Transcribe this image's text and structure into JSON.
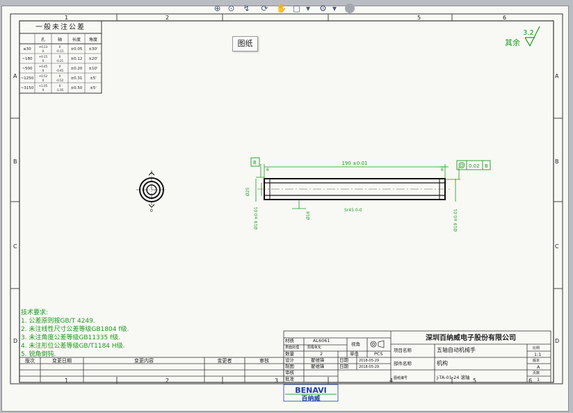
{
  "toolbar": {
    "icons": [
      "zoom-fit-icon",
      "zoom-area-icon",
      "previous-view-icon",
      "rotate-view-icon",
      "pan-icon",
      "display-style-icon",
      "dropdown-icon",
      "view-setting-icon",
      "dropdown-icon"
    ]
  },
  "tooltip": {
    "text": "图纸"
  },
  "border": {
    "top_numbers": [
      "1",
      "2",
      "5",
      "6"
    ],
    "bottom_numbers": [
      "1",
      "2",
      "3",
      "4",
      "5",
      "6"
    ],
    "left_letters": [
      "A",
      "B",
      "C",
      "D"
    ],
    "right_letters": [
      "A",
      "B",
      "C",
      "D"
    ]
  },
  "tolerance_table": {
    "title": "一般未注公差",
    "headers": [
      "孔",
      "轴",
      "长度",
      "角度"
    ],
    "rows": [
      {
        "range": "≤30",
        "hole": "+0.13\n0",
        "shaft": "0\n-0.13",
        "length": "±0.05",
        "angle": "±30'"
      },
      {
        "range": "~180",
        "hole": "+0.15\n0",
        "shaft": "0\n-0.21",
        "length": "±0.12",
        "angle": "±20'"
      },
      {
        "range": "~500",
        "hole": "+0.45\n0",
        "shaft": "0\n-0.45",
        "length": "±0.20",
        "angle": "±10'"
      },
      {
        "range": "~1250",
        "hole": "+0.52\n0",
        "shaft": "0\n-0.52",
        "length": "±0.31",
        "angle": "±5'"
      },
      {
        "range": "~3150",
        "hole": "+1.05\n0",
        "shaft": "0\n-1.05",
        "length": "±0.50",
        "angle": "±5'"
      }
    ]
  },
  "roughness": {
    "value": "3.2",
    "label": "其余"
  },
  "drawing": {
    "datum_label": "B",
    "length_dim": "190 ±0.01",
    "tol_frame_value": "0.02",
    "tol_frame_datum": "B",
    "dim_left_vertical": "Ø25",
    "dim_left_dia": "Ø19 ±0.01",
    "dim_inner": "Ø16",
    "dim_right_dia": "Ø19 ±0.01",
    "center_note": "Sr45 0-0",
    "dim_right_small": "6",
    "dim_left_small": "6",
    "section_mark": "0"
  },
  "notes": {
    "heading": "技术要求:",
    "lines": [
      "1. 公差原则按GB/T 4249.",
      "2. 未注线性尺寸公差等级GB1804  f级.",
      "3. 未注角度公差等级GB11335  f级.",
      "4. 未注形位公差等级GB/T1184  H级.",
      "5. 锐角倒钝."
    ]
  },
  "revision_block": {
    "headers": [
      "版次",
      "变更日期",
      "变更内容",
      "变更者",
      "审核"
    ]
  },
  "title_block": {
    "material_label": "材质",
    "material_value": "AL6061",
    "finish_label": "表面处理",
    "finish_value": "阳极氧化",
    "qty_label": "数量",
    "qty_value": "2",
    "unit_label": "单位",
    "unit_value": "PCS",
    "view_label": "视角",
    "design_label": "设计",
    "design_name": "翟维锋",
    "design_date_label": "日期",
    "design_date": "2018-05-29",
    "draw_label": "制图",
    "draw_name": "翟维锋",
    "draw_date_label": "日期",
    "draw_date": "2018-05-29",
    "check_label": "审核",
    "approve_label": "批准",
    "company": "深圳百纳威电子股份有限公司",
    "project_label": "项目名称",
    "project_value": "五轴自动机械手",
    "part_label": "部件名称",
    "part_value": "机构",
    "drawing_no_label": "图纸编号",
    "drawing_no": "J-TA-01-24 滚轴",
    "scale_label": "比例",
    "scale_value": "1:1",
    "version_label": "版本",
    "version_value": "A",
    "sheet_label": "页数",
    "sheet_value": "1",
    "logo_text": "BENAVI",
    "logo_cn": "百纳威"
  }
}
